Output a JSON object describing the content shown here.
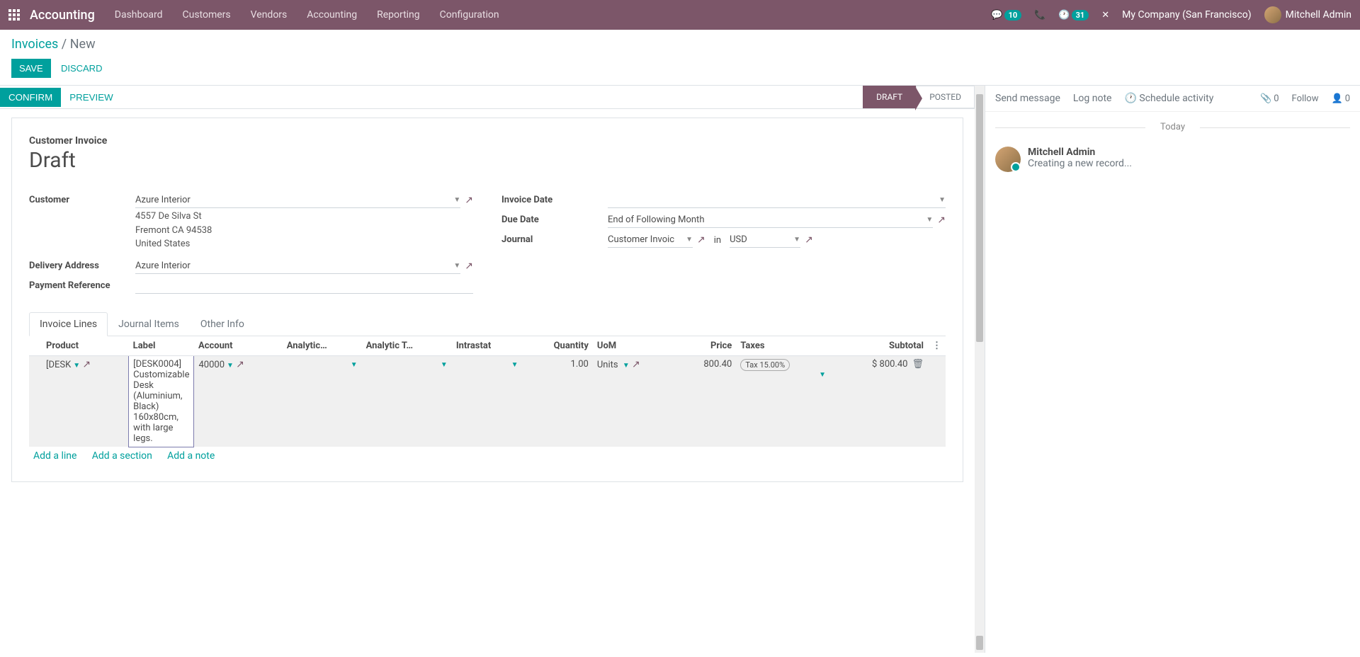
{
  "navbar": {
    "brand": "Accounting",
    "links": [
      "Dashboard",
      "Customers",
      "Vendors",
      "Accounting",
      "Reporting",
      "Configuration"
    ],
    "chat_badge": "10",
    "clock_badge": "31",
    "company": "My Company (San Francisco)",
    "user": "Mitchell Admin"
  },
  "breadcrumb": {
    "root": "Invoices",
    "current": "New"
  },
  "buttons": {
    "save": "Save",
    "discard": "Discard",
    "confirm": "Confirm",
    "preview": "Preview"
  },
  "status": {
    "draft": "Draft",
    "posted": "Posted"
  },
  "form": {
    "title_label": "Customer Invoice",
    "title": "Draft",
    "labels": {
      "customer": "Customer",
      "delivery": "Delivery Address",
      "payref": "Payment Reference",
      "invdate": "Invoice Date",
      "duedate": "Due Date",
      "journal": "Journal"
    },
    "customer": "Azure Interior",
    "address_l1": "4557 De Silva St",
    "address_l2": "Fremont CA 94538",
    "address_l3": "United States",
    "delivery": "Azure Interior",
    "duedate": "End of Following Month",
    "journal": "Customer Invoices",
    "journal_display": "Customer Invoic",
    "in": "in",
    "currency": "USD"
  },
  "tabs": [
    "Invoice Lines",
    "Journal Items",
    "Other Info"
  ],
  "table": {
    "headers": {
      "product": "Product",
      "label": "Label",
      "account": "Account",
      "analytic": "Analytic…",
      "analytic_t": "Analytic T…",
      "intrastat": "Intrastat",
      "quantity": "Quantity",
      "uom": "UoM",
      "price": "Price",
      "taxes": "Taxes",
      "subtotal": "Subtotal"
    },
    "row": {
      "product": "[DESK",
      "label": "[DESK0004] Customizable Desk (Aluminium, Black) 160x80cm, with large legs.",
      "account": "40000",
      "quantity": "1.00",
      "uom": "Units",
      "price": "800.40",
      "tax": "Tax 15.00%",
      "subtotal": "$ 800.40"
    },
    "add_line": "Add a line",
    "add_section": "Add a section",
    "add_note": "Add a note"
  },
  "chatter": {
    "send": "Send message",
    "log": "Log note",
    "schedule": "Schedule activity",
    "attach_count": "0",
    "follow": "Follow",
    "follower_count": "0",
    "today": "Today",
    "msg_author": "Mitchell Admin",
    "msg_body": "Creating a new record..."
  }
}
